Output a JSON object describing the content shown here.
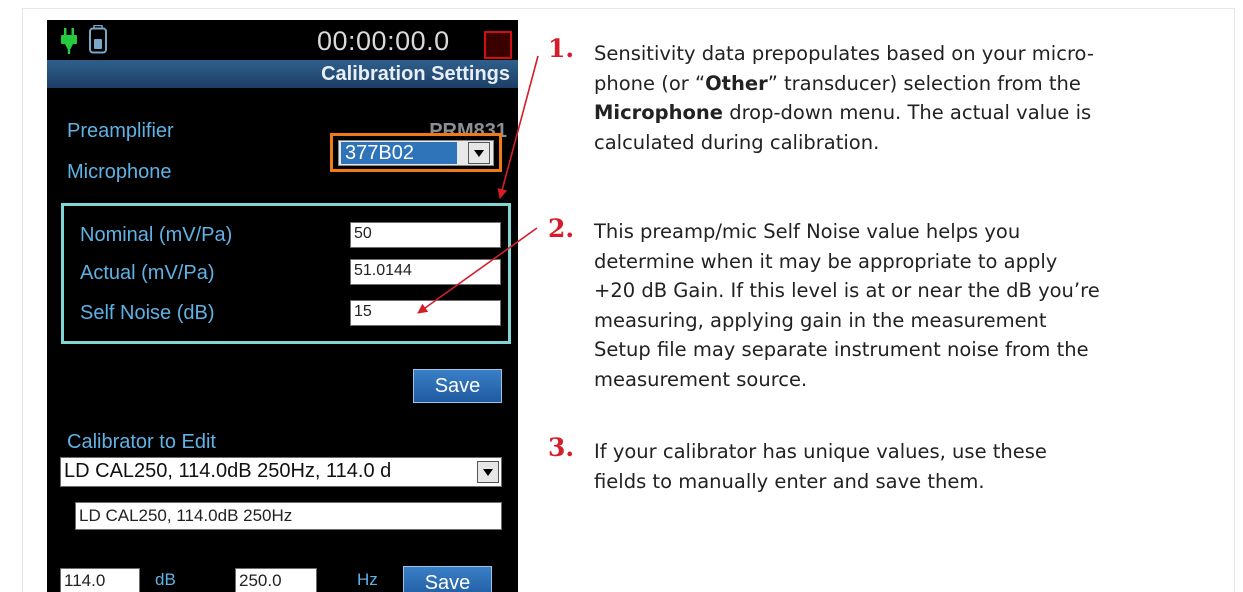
{
  "device": {
    "timer": "00:00:00.0",
    "title": "Calibration Settings",
    "preamplifier_label": "Preamplifier",
    "preamplifier_value": "PRM831",
    "microphone_label": "Microphone",
    "microphone_value": "377B02",
    "nominal_label": "Nominal  (mV/Pa)",
    "nominal_value": "50",
    "actual_label": "Actual  (mV/Pa)",
    "actual_value": "51.0144",
    "self_noise_label": "Self Noise  (dB)",
    "self_noise_value": "15",
    "save_label": "Save",
    "calibrator_label": "Calibrator to Edit",
    "calibrator_value": "LD CAL250, 114.0dB 250Hz, 114.0 d",
    "calibrator_name_value": "LD CAL250, 114.0dB 250Hz",
    "level_value": "114.0",
    "level_unit": "dB",
    "freq_value": "250.0",
    "freq_unit": "Hz",
    "save2_label": "Save"
  },
  "notes": [
    {
      "number": "1.",
      "pre1": "Sensitivity data prepopulates based on your micro-",
      "pre2": "phone (or “",
      "bold1": "Other",
      "mid1": "” transducer) selection from the",
      "bold2": "Microphone",
      "mid2": " drop-down menu. The actual value is",
      "line4": "calculated during calibration."
    },
    {
      "number": "2.",
      "lines": [
        "This preamp/mic Self Noise value helps you",
        "determine when it may be appropriate to apply",
        "+20 dB Gain. If this level is at or near the dB you’re",
        "measuring, applying gain in the measurement",
        "Setup file may separate instrument noise from the",
        "measurement source."
      ]
    },
    {
      "number": "3.",
      "lines": [
        "If your calibrator has unique values, use these",
        "fields to manually enter and save them."
      ]
    }
  ],
  "colors": {
    "accent_red": "#d41e2a",
    "label_blue": "#5fb2e6",
    "highlight_orange": "#f07a1a",
    "highlight_cyan": "#7fd6d6"
  },
  "icons": [
    "plug-icon",
    "battery-icon",
    "stop-icon",
    "chevron-down-icon"
  ]
}
